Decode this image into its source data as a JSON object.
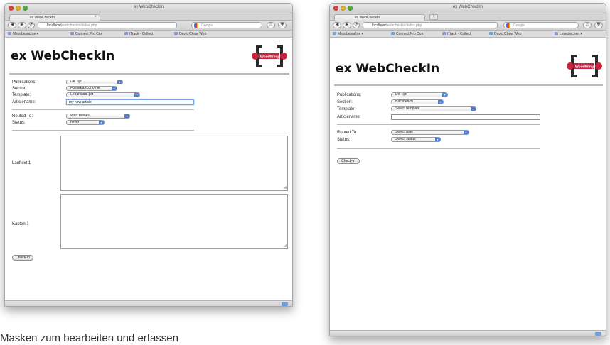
{
  "caption": "Masken zum bearbeiten und erfassen",
  "left": {
    "window_title": "ex WebCheckIn",
    "tab_label": "ex WebCheckIn",
    "url_host": "localhost",
    "url_path": "/webcheckin/index.php",
    "search_placeholder": "Google",
    "bookmarks": [
      "Meistbesuchte",
      "Connect Pro Con",
      "iTrack - Collect",
      "David Chow Web"
    ],
    "page_title": "ex WebCheckIn",
    "labels": {
      "publications": "Publications:",
      "section": "Section:",
      "template": "Template:",
      "articlename": "Articlename:",
      "routed_to": "Routed To:",
      "status": "Status:",
      "laufext": "Lauftext 1",
      "kasten": "Kasten 1"
    },
    "values": {
      "publication": "De Tijd",
      "section": "Politiek&Economie",
      "template": "Leoartikels.gxt",
      "articlename": "my new article",
      "routed_to": "Wart Bleeks",
      "status": "never"
    },
    "checkin_label": "Check-in"
  },
  "right": {
    "window_title": "ex WebCheckIn",
    "tab_label": "ex WebCheckIn",
    "url_host": "localhost",
    "url_path": "/webcheckin/index.php",
    "search_placeholder": "Google",
    "bookmarks": [
      "Meistbesuchte",
      "Connect Pro Con",
      "iTrack - Collect",
      "David Chow Web",
      "Lesezeichen"
    ],
    "page_title": "ex WebCheckIn",
    "labels": {
      "publications": "Publications:",
      "section": "Section:",
      "template": "Template:",
      "articlename": "Articlename:",
      "routed_to": "Routed To:",
      "status": "Status:"
    },
    "values": {
      "publication": "De Tijd",
      "section": "Backbench",
      "template": "Select template",
      "articlename": "",
      "routed_to": "Select user",
      "status": "Select status"
    },
    "checkin_label": "Check-in"
  },
  "colors": {
    "logo_red": "#c9223d",
    "logo_dark": "#2a2a2a",
    "select_arrow": "#4f7fd6",
    "focus_ring": "#7aa7e3"
  }
}
